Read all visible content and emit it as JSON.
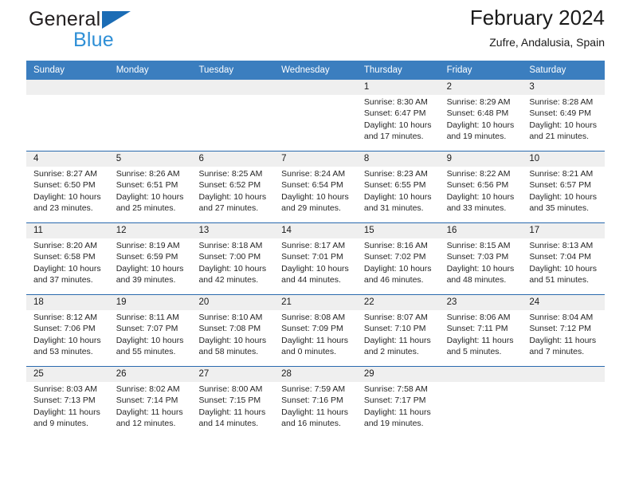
{
  "brand": {
    "word1": "General",
    "word2": "Blue",
    "triangle_color": "#1b6cb5",
    "blue_text_color": "#2e8fd6"
  },
  "header": {
    "title": "February 2024",
    "subtitle": "Zufre, Andalusia, Spain",
    "header_bg": "#3b7ebf",
    "row_line_color": "#2a6aae",
    "daynum_band_bg": "#efefef"
  },
  "weekdays": [
    "Sunday",
    "Monday",
    "Tuesday",
    "Wednesday",
    "Thursday",
    "Friday",
    "Saturday"
  ],
  "weeks": [
    [
      {
        "day": "",
        "lines": [
          "",
          "",
          "",
          ""
        ]
      },
      {
        "day": "",
        "lines": [
          "",
          "",
          "",
          ""
        ]
      },
      {
        "day": "",
        "lines": [
          "",
          "",
          "",
          ""
        ]
      },
      {
        "day": "",
        "lines": [
          "",
          "",
          "",
          ""
        ]
      },
      {
        "day": "1",
        "lines": [
          "Sunrise: 8:30 AM",
          "Sunset: 6:47 PM",
          "Daylight: 10 hours",
          "and 17 minutes."
        ]
      },
      {
        "day": "2",
        "lines": [
          "Sunrise: 8:29 AM",
          "Sunset: 6:48 PM",
          "Daylight: 10 hours",
          "and 19 minutes."
        ]
      },
      {
        "day": "3",
        "lines": [
          "Sunrise: 8:28 AM",
          "Sunset: 6:49 PM",
          "Daylight: 10 hours",
          "and 21 minutes."
        ]
      }
    ],
    [
      {
        "day": "4",
        "lines": [
          "Sunrise: 8:27 AM",
          "Sunset: 6:50 PM",
          "Daylight: 10 hours",
          "and 23 minutes."
        ]
      },
      {
        "day": "5",
        "lines": [
          "Sunrise: 8:26 AM",
          "Sunset: 6:51 PM",
          "Daylight: 10 hours",
          "and 25 minutes."
        ]
      },
      {
        "day": "6",
        "lines": [
          "Sunrise: 8:25 AM",
          "Sunset: 6:52 PM",
          "Daylight: 10 hours",
          "and 27 minutes."
        ]
      },
      {
        "day": "7",
        "lines": [
          "Sunrise: 8:24 AM",
          "Sunset: 6:54 PM",
          "Daylight: 10 hours",
          "and 29 minutes."
        ]
      },
      {
        "day": "8",
        "lines": [
          "Sunrise: 8:23 AM",
          "Sunset: 6:55 PM",
          "Daylight: 10 hours",
          "and 31 minutes."
        ]
      },
      {
        "day": "9",
        "lines": [
          "Sunrise: 8:22 AM",
          "Sunset: 6:56 PM",
          "Daylight: 10 hours",
          "and 33 minutes."
        ]
      },
      {
        "day": "10",
        "lines": [
          "Sunrise: 8:21 AM",
          "Sunset: 6:57 PM",
          "Daylight: 10 hours",
          "and 35 minutes."
        ]
      }
    ],
    [
      {
        "day": "11",
        "lines": [
          "Sunrise: 8:20 AM",
          "Sunset: 6:58 PM",
          "Daylight: 10 hours",
          "and 37 minutes."
        ]
      },
      {
        "day": "12",
        "lines": [
          "Sunrise: 8:19 AM",
          "Sunset: 6:59 PM",
          "Daylight: 10 hours",
          "and 39 minutes."
        ]
      },
      {
        "day": "13",
        "lines": [
          "Sunrise: 8:18 AM",
          "Sunset: 7:00 PM",
          "Daylight: 10 hours",
          "and 42 minutes."
        ]
      },
      {
        "day": "14",
        "lines": [
          "Sunrise: 8:17 AM",
          "Sunset: 7:01 PM",
          "Daylight: 10 hours",
          "and 44 minutes."
        ]
      },
      {
        "day": "15",
        "lines": [
          "Sunrise: 8:16 AM",
          "Sunset: 7:02 PM",
          "Daylight: 10 hours",
          "and 46 minutes."
        ]
      },
      {
        "day": "16",
        "lines": [
          "Sunrise: 8:15 AM",
          "Sunset: 7:03 PM",
          "Daylight: 10 hours",
          "and 48 minutes."
        ]
      },
      {
        "day": "17",
        "lines": [
          "Sunrise: 8:13 AM",
          "Sunset: 7:04 PM",
          "Daylight: 10 hours",
          "and 51 minutes."
        ]
      }
    ],
    [
      {
        "day": "18",
        "lines": [
          "Sunrise: 8:12 AM",
          "Sunset: 7:06 PM",
          "Daylight: 10 hours",
          "and 53 minutes."
        ]
      },
      {
        "day": "19",
        "lines": [
          "Sunrise: 8:11 AM",
          "Sunset: 7:07 PM",
          "Daylight: 10 hours",
          "and 55 minutes."
        ]
      },
      {
        "day": "20",
        "lines": [
          "Sunrise: 8:10 AM",
          "Sunset: 7:08 PM",
          "Daylight: 10 hours",
          "and 58 minutes."
        ]
      },
      {
        "day": "21",
        "lines": [
          "Sunrise: 8:08 AM",
          "Sunset: 7:09 PM",
          "Daylight: 11 hours",
          "and 0 minutes."
        ]
      },
      {
        "day": "22",
        "lines": [
          "Sunrise: 8:07 AM",
          "Sunset: 7:10 PM",
          "Daylight: 11 hours",
          "and 2 minutes."
        ]
      },
      {
        "day": "23",
        "lines": [
          "Sunrise: 8:06 AM",
          "Sunset: 7:11 PM",
          "Daylight: 11 hours",
          "and 5 minutes."
        ]
      },
      {
        "day": "24",
        "lines": [
          "Sunrise: 8:04 AM",
          "Sunset: 7:12 PM",
          "Daylight: 11 hours",
          "and 7 minutes."
        ]
      }
    ],
    [
      {
        "day": "25",
        "lines": [
          "Sunrise: 8:03 AM",
          "Sunset: 7:13 PM",
          "Daylight: 11 hours",
          "and 9 minutes."
        ]
      },
      {
        "day": "26",
        "lines": [
          "Sunrise: 8:02 AM",
          "Sunset: 7:14 PM",
          "Daylight: 11 hours",
          "and 12 minutes."
        ]
      },
      {
        "day": "27",
        "lines": [
          "Sunrise: 8:00 AM",
          "Sunset: 7:15 PM",
          "Daylight: 11 hours",
          "and 14 minutes."
        ]
      },
      {
        "day": "28",
        "lines": [
          "Sunrise: 7:59 AM",
          "Sunset: 7:16 PM",
          "Daylight: 11 hours",
          "and 16 minutes."
        ]
      },
      {
        "day": "29",
        "lines": [
          "Sunrise: 7:58 AM",
          "Sunset: 7:17 PM",
          "Daylight: 11 hours",
          "and 19 minutes."
        ]
      },
      {
        "day": "",
        "lines": [
          "",
          "",
          "",
          ""
        ]
      },
      {
        "day": "",
        "lines": [
          "",
          "",
          "",
          ""
        ]
      }
    ]
  ]
}
